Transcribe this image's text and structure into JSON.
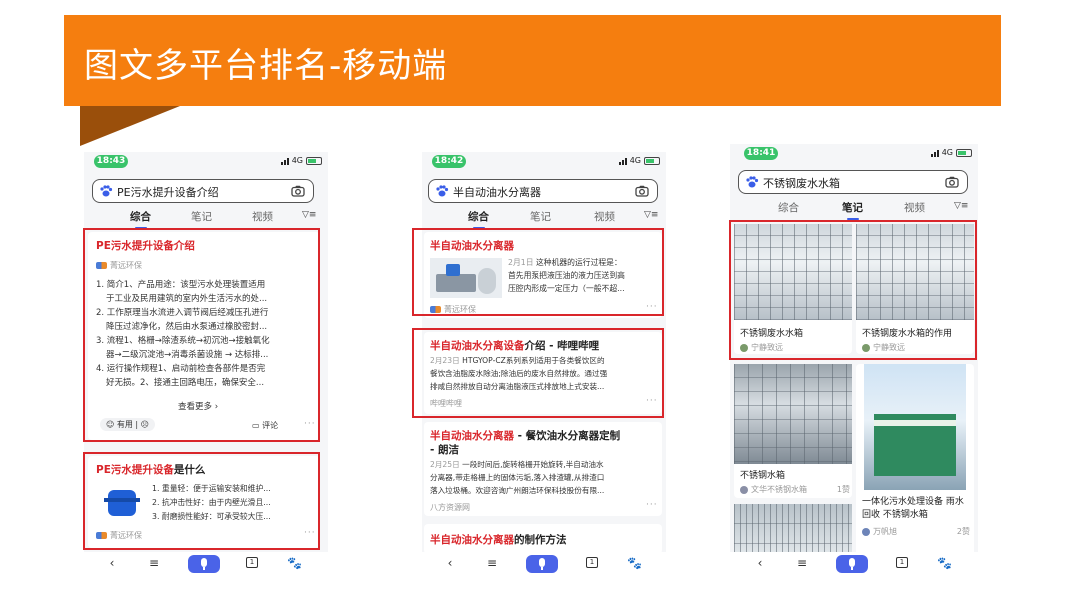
{
  "slide": {
    "title": "图文多平台排名-移动端"
  },
  "colors": {
    "brand_orange": "#f57e0f",
    "highlight_red": "#d9262b",
    "accent_blue": "#4a63e8",
    "status_green": "#39c36a"
  },
  "phones": [
    {
      "status_time": "18:43",
      "network": "4G",
      "search_query": "PE污水提升设备介绍",
      "tabs": [
        "综合",
        "笔记",
        "视频"
      ],
      "active_tab": "综合",
      "results": [
        {
          "title": "PE污水提升设备介绍",
          "source": "菁远环保",
          "lines": [
            "1. 简介1、产品用途：该型污水处理装置适用",
            "于工业及民用建筑的室内外生活污水的处...",
            "2. 工作原理当水流进入调节阀后经减压孔进行",
            "降压过滤净化，然后由水泵通过橡胶密封...",
            "3. 流程1、格栅→除渣系统→初沉池→接触氧化",
            "器→二级沉淀池→消毒杀菌设施 → 达标排...",
            "4. 运行操作规程1、启动前检查各部件是否完",
            "好无损。2、接通主回路电压，确保安全..."
          ],
          "see_more": "查看更多",
          "useful_label": "有用",
          "comment_label": "评论"
        },
        {
          "title_red": "PE污水提升设备",
          "title_rest": "是什么",
          "source": "菁远环保",
          "lines": [
            "1. 重量轻：便于运输安装和维护...",
            "2. 抗冲击性好：由于内壁光滑且...",
            "3. 耐磨损性能好：可承受较大压..."
          ]
        }
      ]
    },
    {
      "status_time": "18:42",
      "network": "4G",
      "search_query": "半自动油水分离器",
      "tabs": [
        "综合",
        "笔记",
        "视频"
      ],
      "active_tab": "综合",
      "results": [
        {
          "title": "半自动油水分离器",
          "date": "2月1日",
          "snippet": [
            "这种机器的运行过程是：",
            "首先用泵把液压油的液力压送到高",
            "压腔内形成一定压力（一般不超..."
          ],
          "source": "菁远环保"
        },
        {
          "title_red": "半自动油水分离设备",
          "title_rest": "介绍 - 哔哩哔哩",
          "date": "2月23日",
          "snippet": [
            "HTGYOP-CZ系列系列适用于各类餐饮区的",
            "餐饮含油脂废水除油;除油后的废水自然排放。通过强",
            "排咸自然排放自动分离油脂液压式排放地上式安装..."
          ],
          "source": "哔哩哔哩"
        },
        {
          "title_red": "半自动油水分离器",
          "title_rest": " - 餐饮油水分离器定制",
          "title_line2": "- 朗洁",
          "date": "2月25日",
          "snippet": [
            "一段时间后,旋转格栅开始旋转,半自动油水",
            "分离器,带走格栅上的固体污垢,落入排渣罐,从排渣口",
            "落入垃圾桶。欢迎咨询广州朗洁环保科技股份有限..."
          ],
          "source": "八方资源网"
        },
        {
          "title_red": "半自动油水分离器",
          "title_rest": "的制作方法"
        }
      ]
    },
    {
      "status_time": "18:41",
      "network": "4G",
      "search_query": "不锈钢废水水箱",
      "tabs": [
        "综合",
        "笔记",
        "视频"
      ],
      "active_tab": "笔记",
      "notes": [
        {
          "title": "不锈钢废水水箱",
          "author": "宁静致远",
          "likes": ""
        },
        {
          "title": "不锈钢废水水箱的作用",
          "author": "宁静致远",
          "likes": ""
        },
        {
          "title": "不锈钢水箱",
          "author": "文华不锈钢水箱",
          "likes": "1赞"
        },
        {
          "title": "一体化污水处理设备 雨水回收 不锈钢水箱",
          "author": "万帆旭",
          "likes": "2赞"
        }
      ]
    }
  ]
}
